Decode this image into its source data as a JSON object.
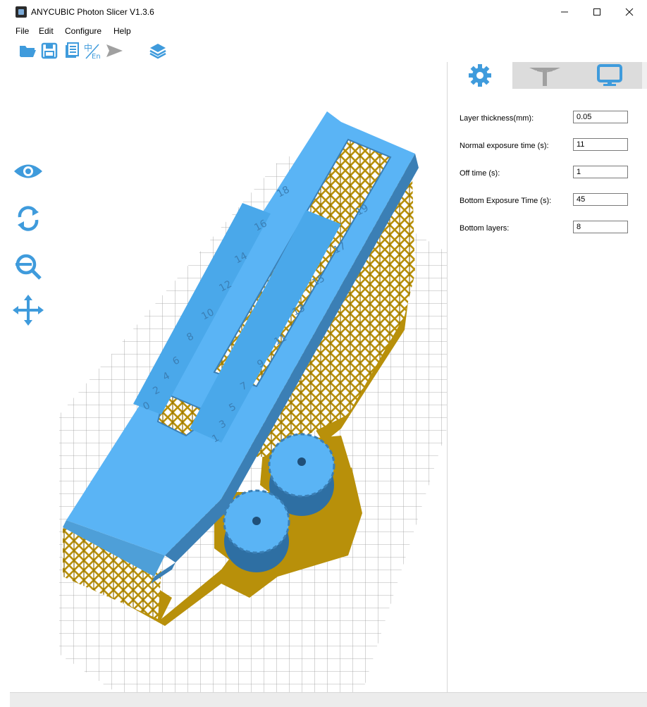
{
  "window": {
    "title": "ANYCUBIC Photon Slicer V1.3.6"
  },
  "menu": {
    "items": [
      "File",
      "Edit",
      "Configure",
      "Help"
    ]
  },
  "toolbar": {
    "icons": [
      "open-folder-icon",
      "save-icon",
      "document-icon",
      "language-icon",
      "send-icon",
      "layers-icon"
    ],
    "accent": "#3f9bdc"
  },
  "view_controls": {
    "icons": [
      "eye-icon",
      "rotate-icon",
      "zoom-icon",
      "move-icon"
    ]
  },
  "tabs": [
    {
      "name": "settings",
      "icon": "gear-icon",
      "active": true
    },
    {
      "name": "supports",
      "icon": "support-icon",
      "active": false
    },
    {
      "name": "display",
      "icon": "monitor-icon",
      "active": false
    }
  ],
  "settings": {
    "layer_thickness": {
      "label": "Layer thickness(mm):",
      "value": "0.05"
    },
    "normal_exposure": {
      "label": "Normal exposure time (s):",
      "value": "11"
    },
    "off_time": {
      "label": "Off time (s):",
      "value": "1"
    },
    "bottom_exposure": {
      "label": "Bottom Exposure Time (s):",
      "value": "45"
    },
    "bottom_layers": {
      "label": "Bottom layers:",
      "value": "8"
    }
  },
  "model": {
    "colors": {
      "model": "#5ab4f5",
      "model_shadow": "#3b7fb5",
      "supports": "#b8900a",
      "grid": "#9a9a9a"
    },
    "left_scale_labels": [
      "0",
      "2",
      "4",
      "6",
      "8",
      "10",
      "12",
      "14",
      "16",
      "18"
    ],
    "right_scale_labels": [
      "1",
      "3",
      "5",
      "7",
      "9",
      "11",
      "13",
      "15",
      "17",
      "19"
    ]
  }
}
